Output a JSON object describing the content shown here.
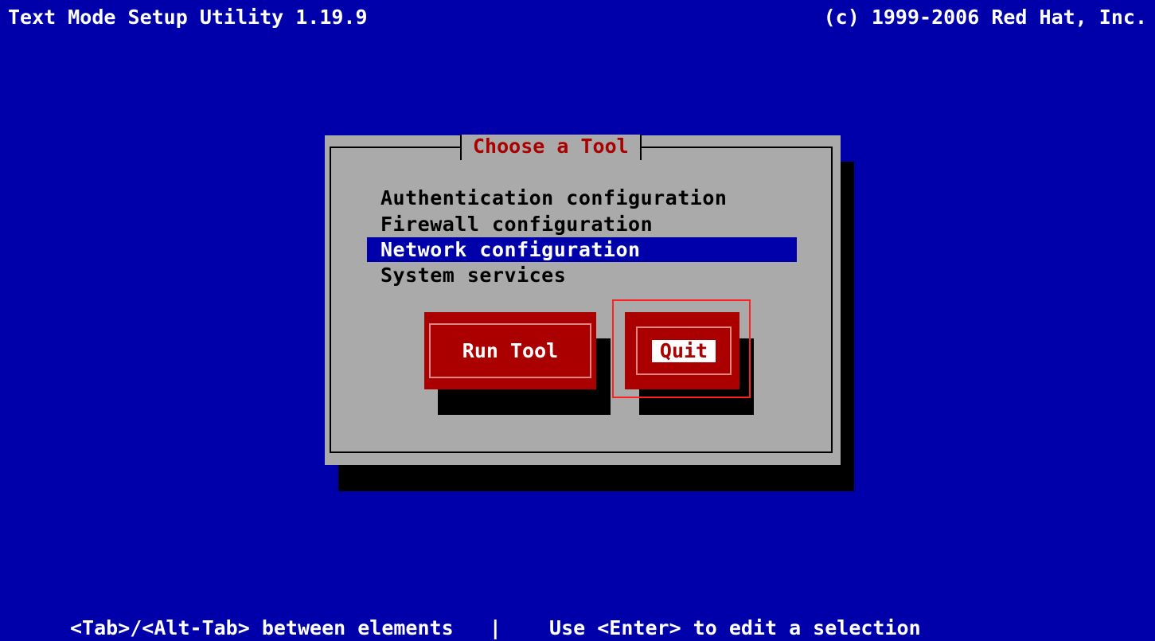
{
  "header": {
    "title": "Text Mode Setup Utility 1.19.9",
    "copyright": "(c) 1999-2006 Red Hat, Inc."
  },
  "dialog": {
    "title": "Choose a Tool",
    "tools": [
      {
        "label": "Authentication configuration",
        "selected": false
      },
      {
        "label": "Firewall configuration",
        "selected": false
      },
      {
        "label": "Network configuration",
        "selected": true
      },
      {
        "label": "System services",
        "selected": false
      }
    ],
    "buttons": {
      "run_label": "Run Tool",
      "quit_label": "Quit"
    }
  },
  "status_bar": {
    "text": "<Tab>/<Alt-Tab> between elements   |    Use <Enter> to edit a selection"
  },
  "colors": {
    "screen_background": "#0000aa",
    "dialog_background": "#aaaaaa",
    "title_text": "#aa0000",
    "button_background": "#aa0000",
    "selection_background": "#0000aa",
    "focus_highlight": "#ff2020"
  }
}
